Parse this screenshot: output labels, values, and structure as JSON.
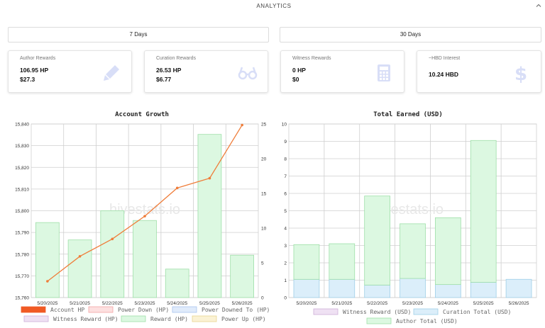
{
  "header": {
    "title": "ANALYTICS",
    "collapse_icon": "chevron-up-icon"
  },
  "periods": {
    "seven_days": "7 Days",
    "thirty_days": "30 Days"
  },
  "cards": {
    "author": {
      "label": "Author Rewards",
      "value_hp": "106.95 HP",
      "value_usd": "$27.3",
      "icon": "pencil-icon"
    },
    "curation": {
      "label": "Curation Rewards",
      "value_hp": "26.53 HP",
      "value_usd": "$6.77",
      "icon": "glasses-icon"
    },
    "witness": {
      "label": "Witness Rewards",
      "value_hp": "0 HP",
      "value_usd": "$0",
      "icon": "calculator-icon"
    },
    "interest": {
      "label": "~HBD Interest",
      "value": "10.24 HBD",
      "icon": "dollar-icon"
    }
  },
  "colors": {
    "reward_fill": "#dcf8e1",
    "reward_stroke": "#9edfa8",
    "curation_fill": "#dbeefa",
    "curation_stroke": "#9fcfe8",
    "line": "#ef7d3a",
    "grid": "#cfcfcf"
  },
  "chart_data": [
    {
      "type": "bar",
      "title": "Account Growth",
      "watermark": "hivestats.io",
      "categories": [
        "5/20/2025",
        "5/21/2025",
        "5/22/2025",
        "5/23/2025",
        "5/24/2025",
        "5/25/2025",
        "5/26/2025"
      ],
      "left_ticks": [
        "15,760",
        "15,770",
        "15,780",
        "15,790",
        "15,800",
        "15,810",
        "15,820",
        "15,830",
        "15,840"
      ],
      "right_ticks": [
        "0",
        "5",
        "10",
        "15",
        "20",
        "25"
      ],
      "ylim": [
        15760,
        15840
      ],
      "y2lim": [
        0,
        25
      ],
      "series": [
        {
          "name": "Account HP",
          "type": "line",
          "axis": "left",
          "values": [
            15767.5,
            15779,
            15787,
            15797.5,
            15810.5,
            15815,
            15839.5
          ]
        },
        {
          "name": "Reward (HP)",
          "type": "bar",
          "axis": "right",
          "values": [
            10.8,
            8.3,
            12.5,
            11.1,
            4.1,
            23.5,
            6.1
          ]
        }
      ],
      "legend": [
        "Account HP",
        "Power Down (HP)",
        "Power Downed To (HP)",
        "Witness Reward (HP)",
        "Reward (HP)",
        "Power Up (HP)"
      ],
      "legend_position": "bottom"
    },
    {
      "type": "bar",
      "title": "Total Earned (USD)",
      "watermark": "hivestats.io",
      "categories": [
        "5/20/2025",
        "5/21/2025",
        "5/22/2025",
        "5/23/2025",
        "5/24/2025",
        "5/25/2025",
        "5/26/2025"
      ],
      "left_ticks": [
        "0",
        "1",
        "2",
        "3",
        "4",
        "5",
        "6",
        "7",
        "8",
        "9",
        "10"
      ],
      "ylim": [
        0,
        10
      ],
      "stacked": true,
      "series": [
        {
          "name": "Curation Total (USD)",
          "values": [
            1.05,
            1.05,
            0.72,
            1.1,
            0.75,
            0.88,
            1.05
          ]
        },
        {
          "name": "Author Total (USD)",
          "values": [
            2.0,
            2.05,
            5.13,
            3.15,
            3.85,
            8.17,
            0.0
          ]
        }
      ],
      "legend": [
        "Witness Reward (USD)",
        "Curation Total (USD)",
        "Author Total (USD)"
      ],
      "legend_position": "bottom"
    }
  ]
}
